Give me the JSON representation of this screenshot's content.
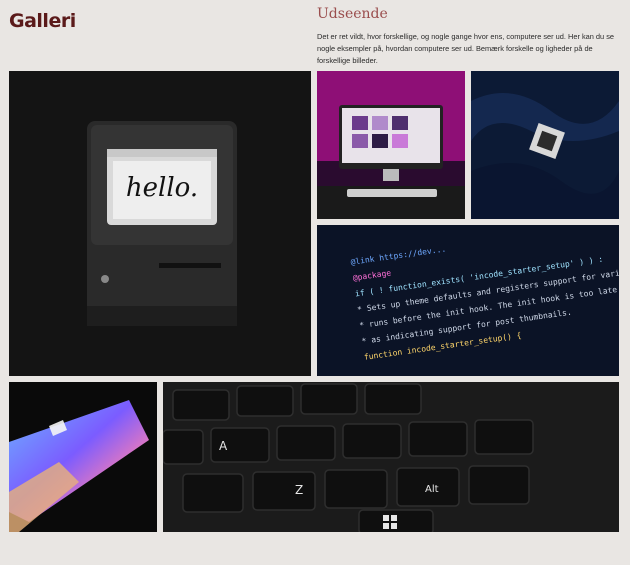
{
  "header": {
    "title": "Galleri"
  },
  "section": {
    "heading": "Udseende",
    "description": "Det er ret vildt, hvor forskellige, og nogle gange hvor ens, computere ser ud. Her kan du se nogle eksempler på, hvordan computere ser ud. Bemærk forskelle og ligheder på de forskellige billeder."
  },
  "gallery": {
    "screen_text": "hello.",
    "code_lines": [
      "@link https://dev...",
      "@package",
      "if ( ! function_exists( 'incode_starter_setup' ) ) :",
      "* Sets up theme defaults and registers support for various WordPress",
      "* runs before the init hook. The init hook is too late for some fe",
      "* as indicating support for post thumbnails.",
      "function incode_starter_setup() {"
    ],
    "key_labels": [
      "A",
      "Z",
      "Alt"
    ],
    "images": [
      {
        "label": "vintage-computer-photo"
      },
      {
        "label": "imac-pink-photo"
      },
      {
        "label": "cpu-chip-photo"
      },
      {
        "label": "code-screen-photo"
      },
      {
        "label": "laptop-rainbow-photo"
      },
      {
        "label": "keyboard-closeup-photo"
      }
    ]
  }
}
